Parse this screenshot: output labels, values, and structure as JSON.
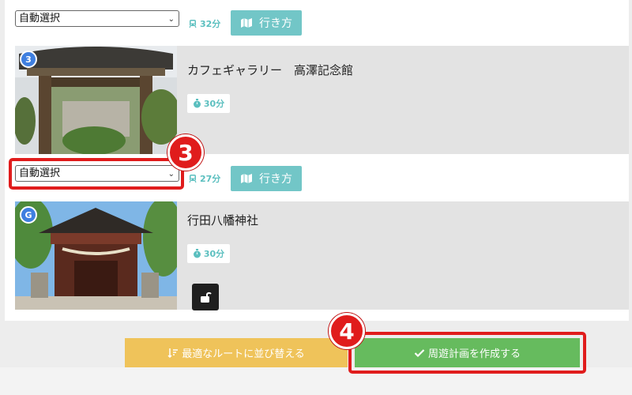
{
  "route": {
    "leg1": {
      "mode_select": "自動選択",
      "travel_time": "32分",
      "directions_label": "行き方"
    },
    "leg2": {
      "mode_select": "自動選択",
      "travel_time": "27分",
      "directions_label": "行き方"
    }
  },
  "spots": [
    {
      "badge": "3",
      "name": "カフェギャラリー　高澤記念館",
      "stay_time": "30分",
      "badge_color": "#3f7fe0"
    },
    {
      "badge": "G",
      "name": "行田八幡神社",
      "stay_time": "30分",
      "badge_color": "#3f7fe0"
    }
  ],
  "annotations": {
    "step3": "3",
    "step4": "4"
  },
  "actions": {
    "sort_label": "最適なルートに並び替える",
    "create_label": "周遊計画を作成する"
  },
  "colors": {
    "teal": "#72c6c7",
    "yellow": "#efc35a",
    "green": "#66bb5e",
    "red": "#e01c1c"
  },
  "icons": [
    "train-icon",
    "map-icon",
    "timer-icon",
    "unlock-icon",
    "sort-icon",
    "check-icon",
    "chevron-down-icon"
  ]
}
